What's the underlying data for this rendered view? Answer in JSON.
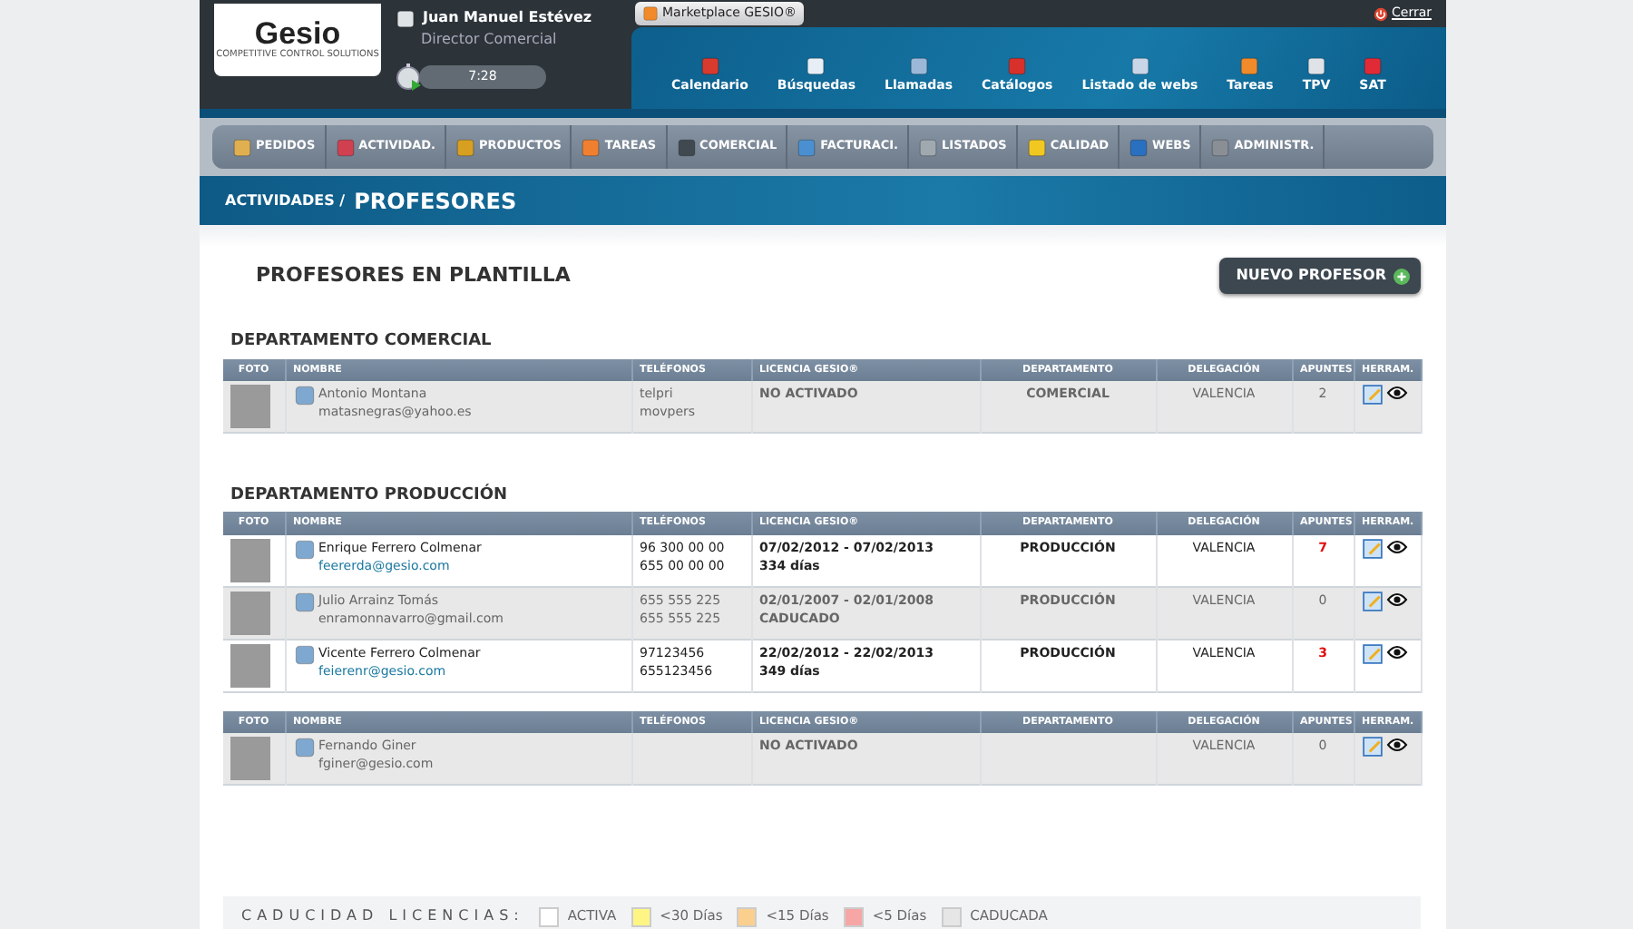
{
  "header": {
    "logo": "Gesio",
    "logo_tagline": "COMPETITIVE CONTROL SOLUTIONS",
    "user_name": "Juan Manuel Estévez",
    "user_role": "Director Comercial",
    "timer": "7:28",
    "marketplace": "Marketplace GESIO®",
    "logout": "Cerrar"
  },
  "toolbar": [
    {
      "label": "Calendario",
      "color": "#d83a2e"
    },
    {
      "label": "Búsquedas",
      "color": "#e8eef5"
    },
    {
      "label": "Llamadas",
      "color": "#9bb8d8"
    },
    {
      "label": "Catálogos",
      "color": "#d8302a"
    },
    {
      "label": "Listado de webs",
      "color": "#c9d6e8"
    },
    {
      "label": "Tareas",
      "color": "#f08a2a"
    },
    {
      "label": "TPV",
      "color": "#dfe3e8"
    },
    {
      "label": "SAT",
      "color": "#e02b36"
    }
  ],
  "menu": [
    {
      "label": "PEDIDOS",
      "color": "#e0b050"
    },
    {
      "label": "ACTIVIDAD.",
      "color": "#d04050"
    },
    {
      "label": "PRODUCTOS",
      "color": "#d8a020"
    },
    {
      "label": "TAREAS",
      "color": "#f08030"
    },
    {
      "label": "COMERCIAL",
      "color": "#404850"
    },
    {
      "label": "FACTURACI.",
      "color": "#4a90d0"
    },
    {
      "label": "LISTADOS",
      "color": "#a0a8b0"
    },
    {
      "label": "CALIDAD",
      "color": "#f0c820"
    },
    {
      "label": "WEBS",
      "color": "#2a70c0"
    },
    {
      "label": "ADMINISTR.",
      "color": "#8a8f96"
    }
  ],
  "breadcrumb": {
    "parent": "ACTIVIDADES /",
    "current": "PROFESORES"
  },
  "page_title": "PROFESORES EN PLANTILLA",
  "new_button": "NUEVO PROFESOR",
  "departments": [
    {
      "title": "DEPARTAMENTO COMERCIAL",
      "columns": [
        "FOTO",
        "NOMBRE",
        "TELÉFONOS",
        "LICENCIA GESIO®",
        "DEPARTAMENTO",
        "DELEGACIÓN",
        "APUNTES",
        "HERRAM."
      ],
      "rows": [
        {
          "name": "Antonio Montana",
          "email": "matasnegras@yahoo.es",
          "phones": [
            "telpri",
            "movpers"
          ],
          "license": [
            "NO ACTIVADO"
          ],
          "department": "COMERCIAL",
          "delegation": "VALENCIA",
          "notes": "2",
          "shaded": true,
          "alert": false
        }
      ]
    },
    {
      "title": "DEPARTAMENTO PRODUCCIÓN",
      "columns": [
        "FOTO",
        "NOMBRE",
        "TELÉFONOS",
        "LICENCIA GESIO®",
        "DEPARTAMENTO",
        "DELEGACIÓN",
        "APUNTES",
        "HERRAM."
      ],
      "rows": [
        {
          "name": "Enrique Ferrero Colmenar",
          "email": "feererda@gesio.com",
          "phones": [
            "96 300 00 00",
            "655 00 00 00"
          ],
          "license": [
            "07/02/2012 - 07/02/2013",
            "334 días"
          ],
          "department": "PRODUCCIÓN",
          "delegation": "VALENCIA",
          "notes": "7",
          "shaded": false,
          "alert": true
        },
        {
          "name": "Julio Arrainz Tomás",
          "email": "enramonnavarro@gmail.com",
          "phones": [
            "655 555 225",
            "655 555 225"
          ],
          "license": [
            "02/01/2007 - 02/01/2008",
            "CADUCADO"
          ],
          "department": "PRODUCCIÓN",
          "delegation": "VALENCIA",
          "notes": "0",
          "shaded": true,
          "alert": false
        },
        {
          "name": "Vicente Ferrero Colmenar",
          "email": "feierenr@gesio.com",
          "phones": [
            "97123456",
            "655123456"
          ],
          "license": [
            "22/02/2012 - 22/02/2013",
            "349 días"
          ],
          "department": "PRODUCCIÓN",
          "delegation": "VALENCIA",
          "notes": "3",
          "shaded": false,
          "alert": true
        }
      ]
    },
    {
      "columns": [
        "FOTO",
        "NOMBRE",
        "TELÉFONOS",
        "LICENCIA GESIO®",
        "DEPARTAMENTO",
        "DELEGACIÓN",
        "APUNTES",
        "HERRAM."
      ],
      "rows": [
        {
          "name": "Fernando Giner",
          "email": "fginer@gesio.com",
          "license": [
            "NO ACTIVADO"
          ],
          "delegation": "VALENCIA",
          "notes": "0",
          "shaded": true,
          "alert": false
        }
      ]
    }
  ],
  "legend": {
    "title": "CADUCIDAD LICENCIAS:",
    "items": [
      {
        "label": "ACTIVA",
        "color": "#ffffff"
      },
      {
        "label": "<30 Días",
        "color": "#fff585"
      },
      {
        "label": "<15 Días",
        "color": "#fbcf8e"
      },
      {
        "label": "<5 Días",
        "color": "#f7a6a6"
      },
      {
        "label": "CADUCADA",
        "color": "#e6e6e6"
      }
    ]
  }
}
